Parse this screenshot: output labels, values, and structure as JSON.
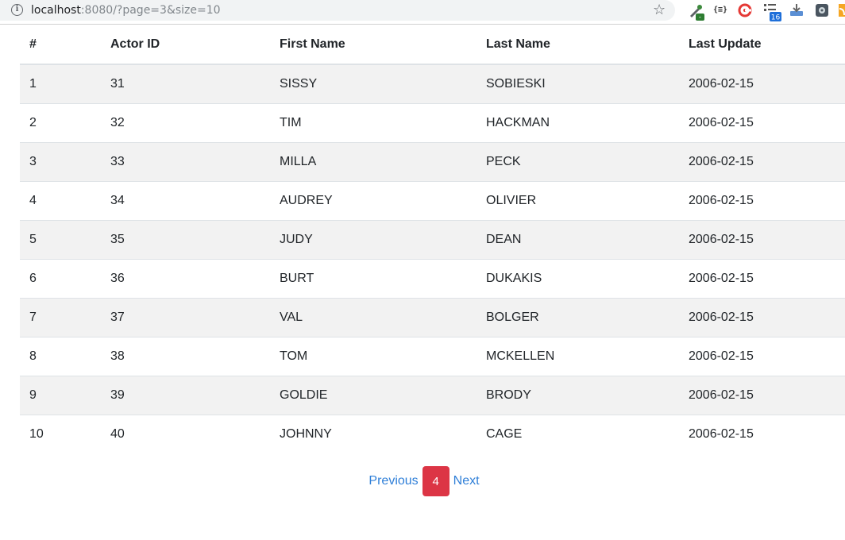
{
  "browser": {
    "url_host": "localhost",
    "url_path": ":8080/?page=3&size=10",
    "ext_badge_green": "-",
    "ext_braces": "{≡}",
    "ext_badge_count": "16"
  },
  "table": {
    "headers": [
      "#",
      "Actor ID",
      "First Name",
      "Last Name",
      "Last Update"
    ],
    "rows": [
      [
        "1",
        "31",
        "SISSY",
        "SOBIESKI",
        "2006-02-15"
      ],
      [
        "2",
        "32",
        "TIM",
        "HACKMAN",
        "2006-02-15"
      ],
      [
        "3",
        "33",
        "MILLA",
        "PECK",
        "2006-02-15"
      ],
      [
        "4",
        "34",
        "AUDREY",
        "OLIVIER",
        "2006-02-15"
      ],
      [
        "5",
        "35",
        "JUDY",
        "DEAN",
        "2006-02-15"
      ],
      [
        "6",
        "36",
        "BURT",
        "DUKAKIS",
        "2006-02-15"
      ],
      [
        "7",
        "37",
        "VAL",
        "BOLGER",
        "2006-02-15"
      ],
      [
        "8",
        "38",
        "TOM",
        "MCKELLEN",
        "2006-02-15"
      ],
      [
        "9",
        "39",
        "GOLDIE",
        "BRODY",
        "2006-02-15"
      ],
      [
        "10",
        "40",
        "JOHNNY",
        "CAGE",
        "2006-02-15"
      ]
    ]
  },
  "pagination": {
    "previous_label": "Previous",
    "current_page": "4",
    "next_label": "Next"
  },
  "colors": {
    "current_page_bg": "#dc3545",
    "link": "#2f7fd8",
    "stripe": "#f2f2f2"
  },
  "icons": [
    "info-icon",
    "star-icon",
    "eyedropper-extension-icon",
    "json-extension-icon",
    "target-extension-icon",
    "checklist-extension-icon",
    "download-extension-icon",
    "puzzle-extension-icon",
    "rss-extension-icon"
  ]
}
